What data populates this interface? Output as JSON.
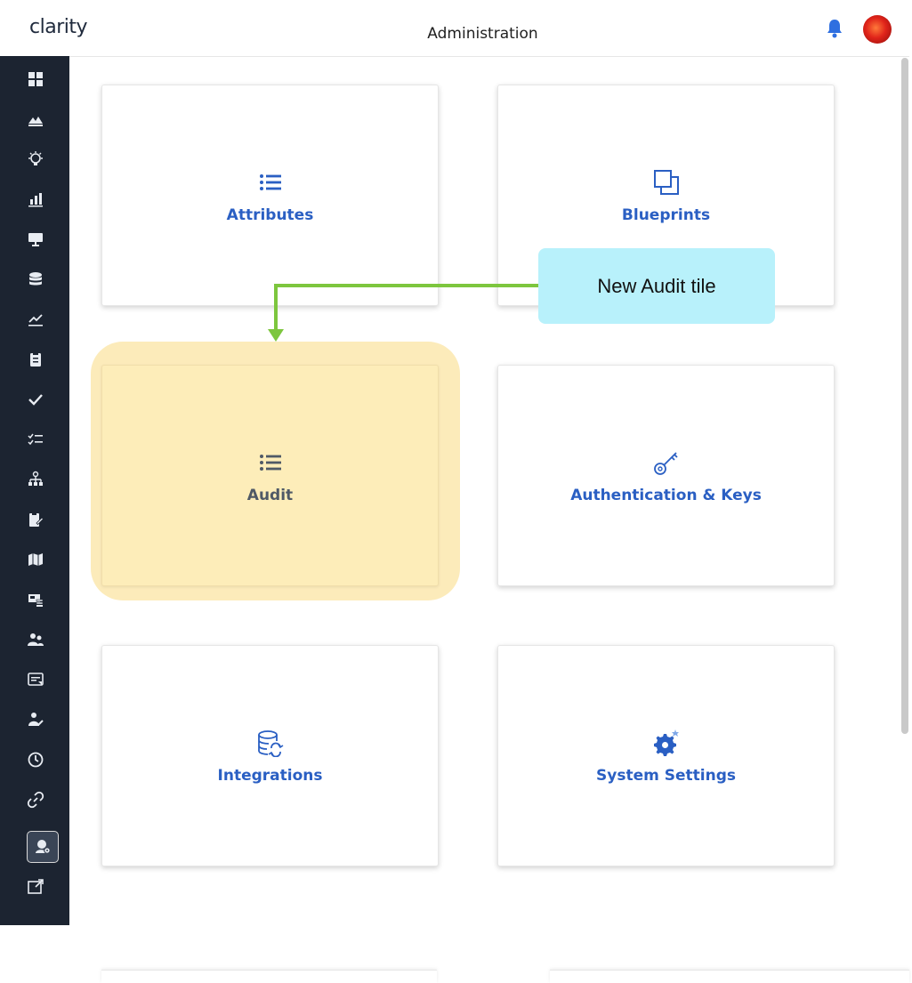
{
  "header": {
    "logo": "clarity",
    "title": "Administration"
  },
  "sidebar": {
    "icons": [
      "dashboard-grid-icon",
      "mountain-chart-icon",
      "lightbulb-icon",
      "bar-chart-icon",
      "monitor-icon",
      "database-icon",
      "line-chart-icon",
      "clipboard-icon",
      "checkmark-icon",
      "checklist-icon",
      "org-chart-icon",
      "clipboard-edit-icon",
      "map-icon",
      "screen-money-icon",
      "users-icon",
      "form-icon",
      "user-edit-icon",
      "clock-icon",
      "link-icon",
      "admin-settings-icon",
      "external-link-icon"
    ],
    "active_index": 19
  },
  "tiles": [
    {
      "label": "Attributes",
      "icon": "list-icon"
    },
    {
      "label": "Blueprints",
      "icon": "layers-icon"
    },
    {
      "label": "Audit",
      "icon": "list-icon"
    },
    {
      "label": "Authentication & Keys",
      "icon": "key-icon"
    },
    {
      "label": "Integrations",
      "icon": "database-sync-icon"
    },
    {
      "label": "System Settings",
      "icon": "gear-icon"
    }
  ],
  "callout": {
    "text": "New Audit tile"
  },
  "colors": {
    "accent": "#2a5fc3",
    "sidebar": "#1c2431",
    "highlight": "#fdedb9",
    "callout": "#b8f1fb",
    "arrow": "#7dc63e"
  }
}
